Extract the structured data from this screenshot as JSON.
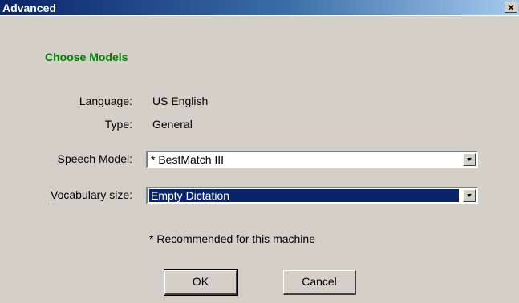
{
  "window": {
    "title": "Advanced",
    "close_glyph": "×"
  },
  "section_heading": "Choose Models",
  "info": {
    "language_label": "Language:",
    "language_value": "US English",
    "type_label": "Type:",
    "type_value": "General"
  },
  "speech_model": {
    "label_accel": "S",
    "label_rest": "peech Model:",
    "selected": "* BestMatch III"
  },
  "vocabulary": {
    "label_accel": "V",
    "label_rest": "ocabulary size:",
    "selected": "Empty Dictation"
  },
  "note": "* Recommended for this machine",
  "buttons": {
    "ok": "OK",
    "cancel": "Cancel"
  },
  "colors": {
    "titlebar_start": "#0a246a",
    "heading": "#008000",
    "selection": "#0a246a",
    "face": "#d4d0c8"
  }
}
